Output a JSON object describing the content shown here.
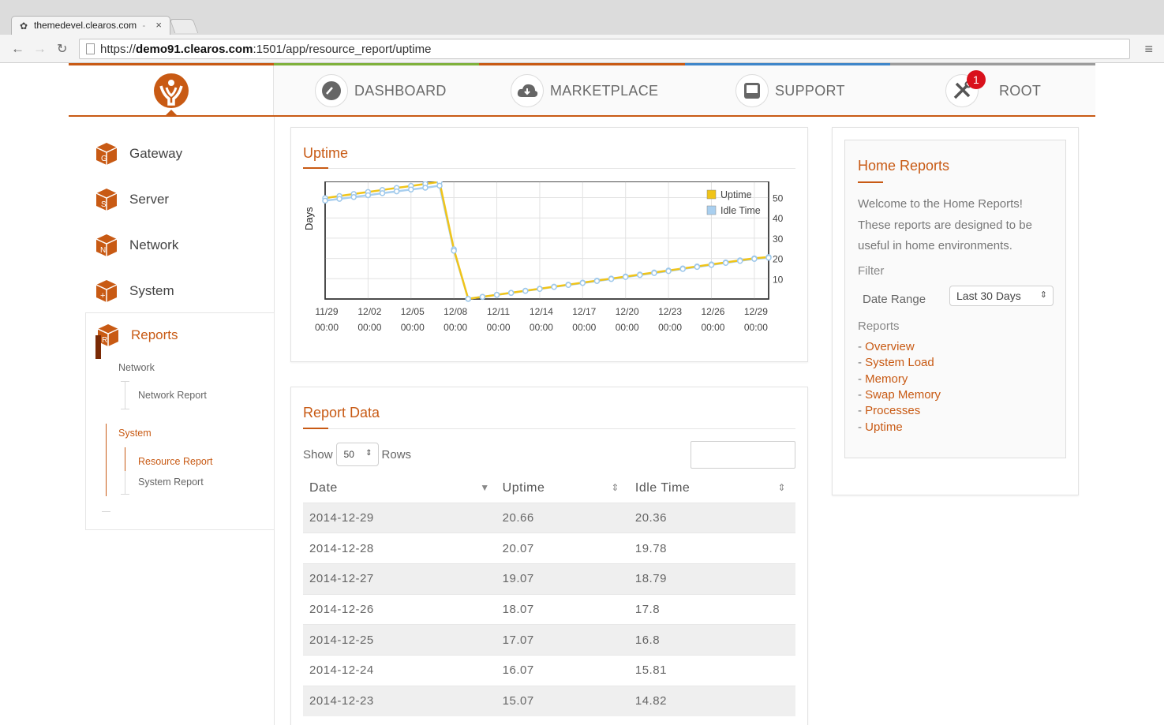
{
  "browser": {
    "tab_title": "themedevel.clearos.com",
    "tab_title_suffix": "-",
    "tab_close": "×",
    "url_scheme": "https://",
    "url_host": "demo91.clearos.com",
    "url_rest": ":1501/app/resource_report/uptime"
  },
  "topnav": {
    "items": [
      {
        "label": "DASHBOARD",
        "icon": "dashboard-gauge-icon"
      },
      {
        "label": "MARKETPLACE",
        "icon": "cloud-download-icon"
      },
      {
        "label": "SUPPORT",
        "icon": "inbox-tray-icon"
      },
      {
        "label": "ROOT",
        "icon": "tools-icon",
        "badge": "1"
      }
    ],
    "stripe_colors": [
      "#c85a14",
      "#7fb13c",
      "#c85a14",
      "#3f86c9",
      "#9c9c9c"
    ]
  },
  "sidebar": {
    "items": [
      {
        "label": "Gateway",
        "letter": "G"
      },
      {
        "label": "Server",
        "letter": "S"
      },
      {
        "label": "Network",
        "letter": "N"
      },
      {
        "label": "System",
        "letter": "+"
      }
    ],
    "reports": {
      "label": "Reports",
      "letter": "R",
      "groups": [
        {
          "label": "Network",
          "items": [
            {
              "label": "Network Report",
              "active": false
            }
          ]
        },
        {
          "label": "System",
          "items": [
            {
              "label": "Resource Report",
              "active": true
            },
            {
              "label": "System Report",
              "active": false
            }
          ]
        }
      ]
    }
  },
  "uptime_panel": {
    "title": "Uptime"
  },
  "chart_data": {
    "type": "line",
    "ylabel": "Days",
    "xlabel": "",
    "ylim": [
      0,
      58
    ],
    "yticks": [
      10,
      20,
      30,
      40,
      50
    ],
    "x_tick_labels": [
      [
        "11/29",
        "00:00"
      ],
      [
        "12/02",
        "00:00"
      ],
      [
        "12/05",
        "00:00"
      ],
      [
        "12/08",
        "00:00"
      ],
      [
        "12/11",
        "00:00"
      ],
      [
        "12/14",
        "00:00"
      ],
      [
        "12/17",
        "00:00"
      ],
      [
        "12/20",
        "00:00"
      ],
      [
        "12/23",
        "00:00"
      ],
      [
        "12/26",
        "00:00"
      ],
      [
        "12/29",
        "00:00"
      ]
    ],
    "x_days": [
      0,
      3,
      6,
      9,
      12,
      15,
      18,
      21,
      24,
      27,
      30
    ],
    "legend_placement": "top-right",
    "grid": true,
    "series": [
      {
        "name": "Uptime",
        "color": "#f0c419",
        "points": [
          [
            0,
            49.8
          ],
          [
            1,
            50.8
          ],
          [
            2,
            51.8
          ],
          [
            3,
            52.8
          ],
          [
            4,
            53.8
          ],
          [
            5,
            54.8
          ],
          [
            6,
            55.8
          ],
          [
            7,
            56.8
          ],
          [
            8,
            57.8
          ],
          [
            9,
            24.5
          ],
          [
            10,
            0.07
          ],
          [
            11,
            1.07
          ],
          [
            12,
            2.07
          ],
          [
            13,
            3.07
          ],
          [
            14,
            4.07
          ],
          [
            15,
            5.07
          ],
          [
            16,
            6.07
          ],
          [
            17,
            7.07
          ],
          [
            18,
            8.07
          ],
          [
            19,
            9.07
          ],
          [
            20,
            10.07
          ],
          [
            21,
            11.07
          ],
          [
            22,
            12.07
          ],
          [
            23,
            13.07
          ],
          [
            24,
            14.07
          ],
          [
            25,
            15.07
          ],
          [
            26,
            16.07
          ],
          [
            27,
            17.07
          ],
          [
            28,
            18.07
          ],
          [
            29,
            19.07
          ],
          [
            30,
            20.07
          ],
          [
            31,
            20.66
          ]
        ]
      },
      {
        "name": "Idle Time",
        "color": "#a9cfef",
        "points": [
          [
            0,
            48.5
          ],
          [
            1,
            49.4
          ],
          [
            2,
            50.3
          ],
          [
            3,
            51.2
          ],
          [
            4,
            52.2
          ],
          [
            5,
            53.1
          ],
          [
            6,
            54
          ],
          [
            7,
            54.9
          ],
          [
            8,
            55.9
          ],
          [
            9,
            23.8
          ],
          [
            10,
            0.06
          ],
          [
            11,
            1.04
          ],
          [
            12,
            2.02
          ],
          [
            13,
            3
          ],
          [
            14,
            3.98
          ],
          [
            15,
            4.96
          ],
          [
            16,
            5.94
          ],
          [
            17,
            6.92
          ],
          [
            18,
            7.9
          ],
          [
            19,
            8.88
          ],
          [
            20,
            9.86
          ],
          [
            21,
            10.84
          ],
          [
            22,
            11.82
          ],
          [
            23,
            12.8
          ],
          [
            24,
            13.78
          ],
          [
            25,
            14.82
          ],
          [
            26,
            15.81
          ],
          [
            27,
            16.8
          ],
          [
            28,
            17.8
          ],
          [
            29,
            18.79
          ],
          [
            30,
            19.78
          ],
          [
            31,
            20.36
          ]
        ]
      }
    ]
  },
  "report_data": {
    "title": "Report Data",
    "show_label": "Show",
    "rows_value": "50",
    "rows_label": "Rows",
    "columns": [
      "Date",
      "Uptime",
      "Idle Time"
    ],
    "rows": [
      [
        "2014-12-29",
        "20.66",
        "20.36"
      ],
      [
        "2014-12-28",
        "20.07",
        "19.78"
      ],
      [
        "2014-12-27",
        "19.07",
        "18.79"
      ],
      [
        "2014-12-26",
        "18.07",
        "17.8"
      ],
      [
        "2014-12-25",
        "17.07",
        "16.8"
      ],
      [
        "2014-12-24",
        "16.07",
        "15.81"
      ],
      [
        "2014-12-23",
        "15.07",
        "14.82"
      ]
    ]
  },
  "home_reports": {
    "title": "Home Reports",
    "intro": "Welcome to the Home Reports! These reports are designed to be useful in home environments.",
    "filter_label": "Filter",
    "date_range_label": "Date Range",
    "date_range_value": "Last 30 Days",
    "reports_label": "Reports",
    "links": [
      "Overview",
      "System Load",
      "Memory",
      "Swap Memory",
      "Processes",
      "Uptime"
    ],
    "link_prefix": "- "
  },
  "colors": {
    "accent": "#c85a14",
    "badge": "#d9111c"
  }
}
